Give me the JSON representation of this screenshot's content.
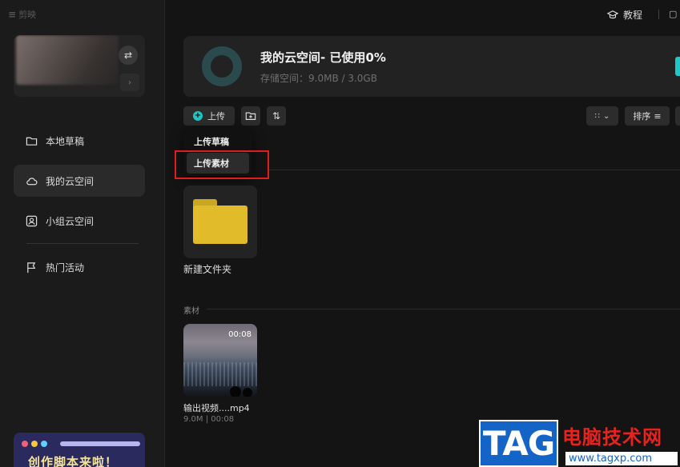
{
  "app": {
    "brand": "剪映"
  },
  "topbar": {
    "tutorial_label": "教程"
  },
  "sidebar": {
    "items": [
      {
        "label": "本地草稿",
        "icon": "folder-icon",
        "active": false
      },
      {
        "label": "我的云空间",
        "icon": "cloud-icon",
        "active": true
      },
      {
        "label": "小组云空间",
        "icon": "group-cloud-icon",
        "active": false
      },
      {
        "label": "热门活动",
        "icon": "flag-icon",
        "active": false
      }
    ],
    "promo_text": "创作脚本来啦！"
  },
  "storage": {
    "title": "我的云空间- 已使用0%",
    "subtitle": "存储空间：9.0MB / 3.0GB",
    "used_fraction": 0.0,
    "accent_color": "#1ec8c8"
  },
  "toolbar": {
    "upload_label": "上传",
    "sort_label": "排序"
  },
  "upload_menu": {
    "items": [
      "上传草稿",
      "上传素材"
    ],
    "highlighted_index": 1
  },
  "content": {
    "folder": {
      "name": "新建文件夹"
    },
    "materials_section": "素材",
    "video": {
      "name": "输出视频....mp4",
      "meta": "9.0M | 00:08",
      "duration": "00:08"
    }
  },
  "watermark": {
    "logo": "TAG",
    "site_name": "电脑技术网",
    "url": "www.tagxp.com"
  }
}
